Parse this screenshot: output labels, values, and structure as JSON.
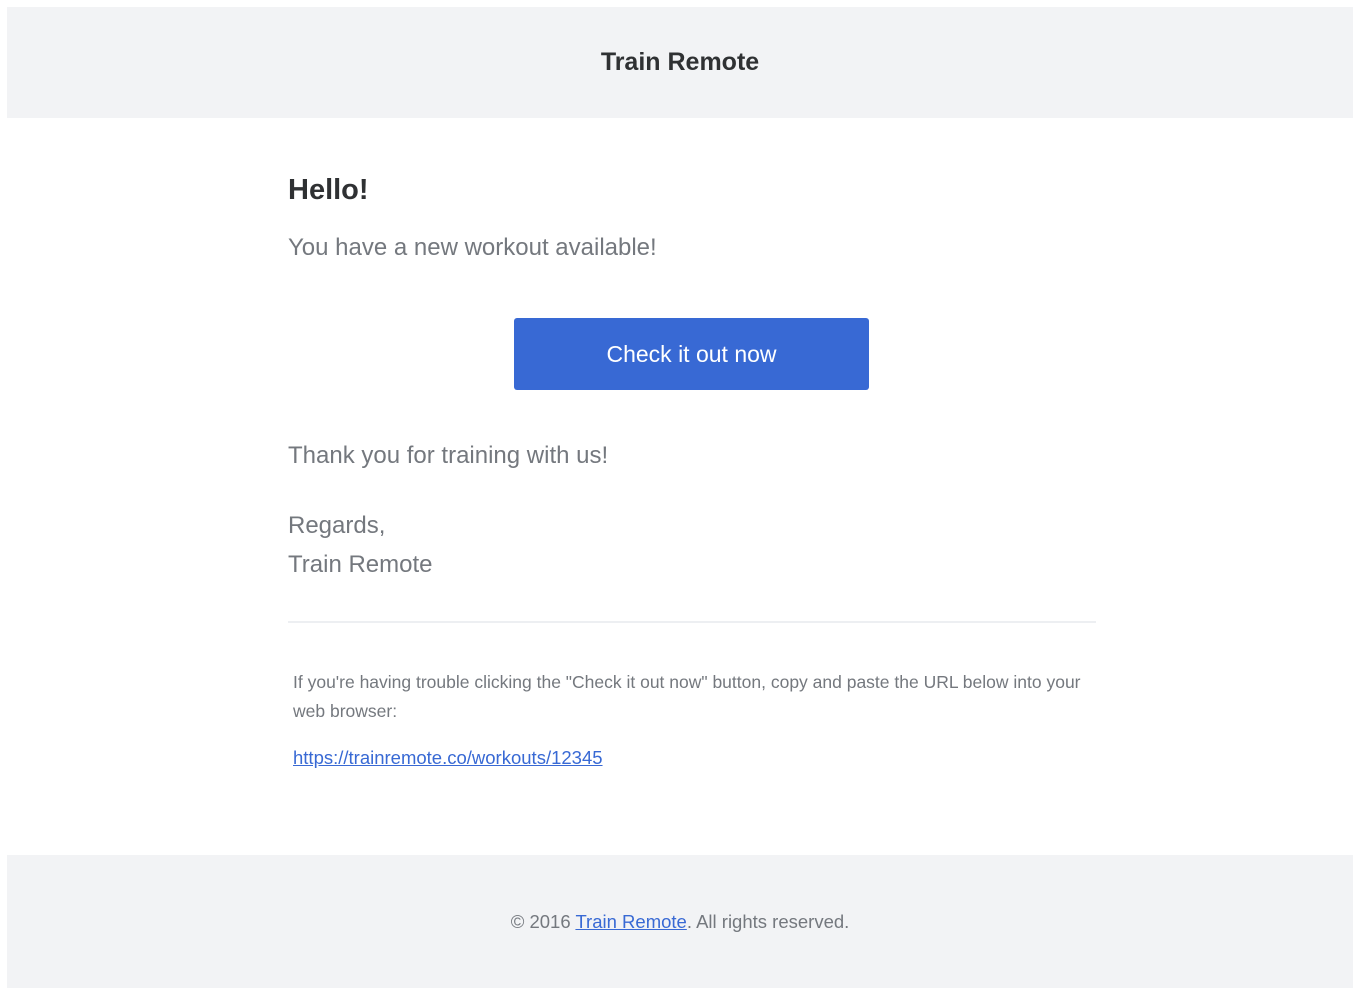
{
  "header": {
    "brand": "Train Remote"
  },
  "body": {
    "greeting": "Hello!",
    "intro": "You have a new workout available!",
    "button_label": "Check it out now",
    "thanks": "Thank you for training with us!",
    "regards": "Regards,",
    "signature": "Train Remote",
    "trouble_text": "If you're having trouble clicking the \"Check it out now\" button, copy and paste the URL below into your web browser:",
    "url": "https://trainremote.co/workouts/12345"
  },
  "footer": {
    "prefix": "© 2016 ",
    "link_text": "Train Remote",
    "suffix": ". All rights reserved."
  },
  "colors": {
    "accent": "#3869d4",
    "header_bg": "#f2f3f5",
    "heading_text": "#2f3133",
    "body_text": "#74787e"
  }
}
